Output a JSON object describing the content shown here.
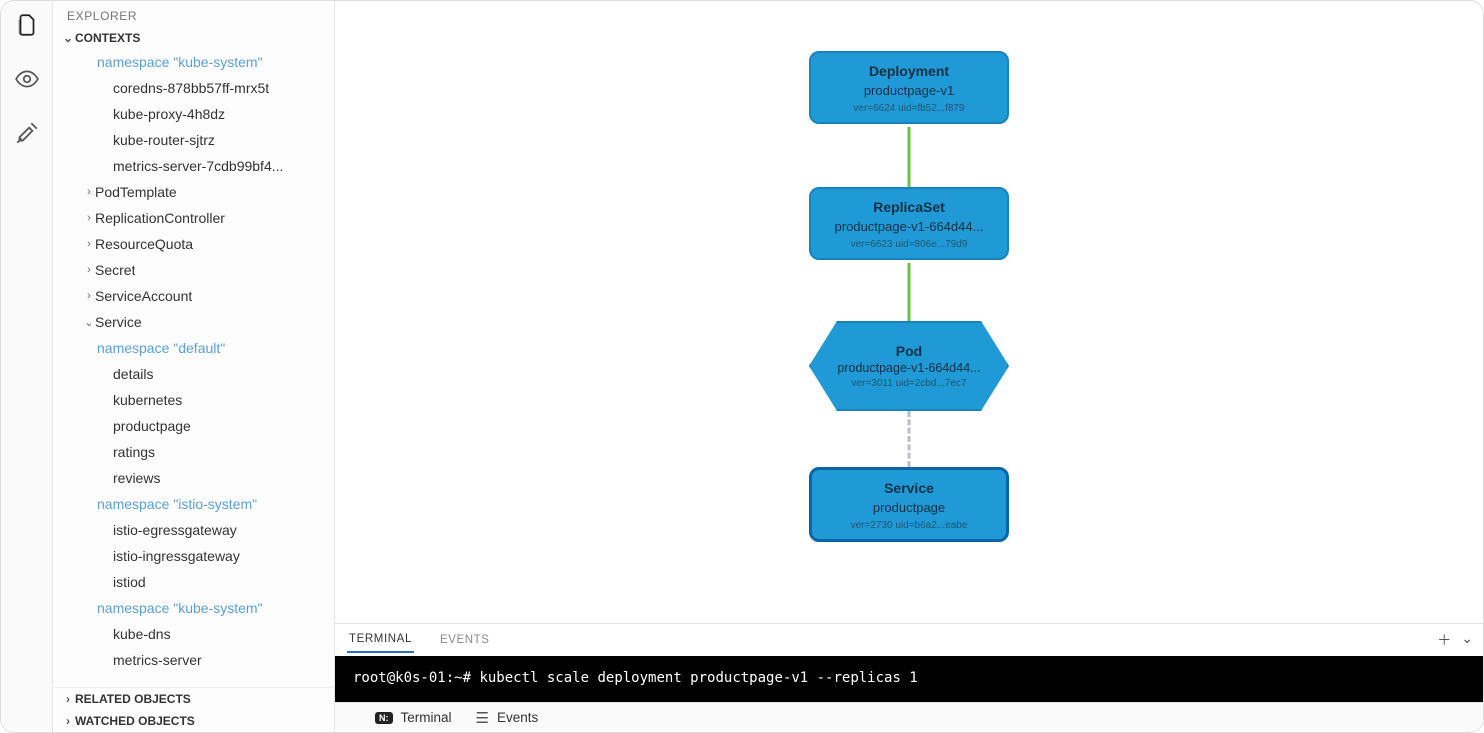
{
  "sidebar": {
    "header": "EXPLORER",
    "sections": {
      "contexts": "CONTEXTS",
      "related": "RELATED OBJECTS",
      "watched": "WATCHED OBJECTS"
    },
    "tree": {
      "namespace_kube_system_top": "namespace \"kube-system\"",
      "pods_ks": [
        "coredns-878bb57ff-mrx5t",
        "kube-proxy-4h8dz",
        "kube-router-sjtrz",
        "metrics-server-7cdb99bf4..."
      ],
      "kinds": [
        "PodTemplate",
        "ReplicationController",
        "ResourceQuota",
        "Secret",
        "ServiceAccount"
      ],
      "service_kind": "Service",
      "ns_default": "namespace \"default\"",
      "svc_default": [
        "details",
        "kubernetes",
        "productpage",
        "ratings",
        "reviews"
      ],
      "ns_istio": "namespace \"istio-system\"",
      "svc_istio": [
        "istio-egressgateway",
        "istio-ingressgateway",
        "istiod"
      ],
      "ns_ks2": "namespace \"kube-system\"",
      "svc_ks": [
        "kube-dns",
        "metrics-server"
      ]
    }
  },
  "graph": {
    "deployment": {
      "type": "Deployment",
      "name": "productpage-v1",
      "meta": "ver=6624 uid=fb52...f879"
    },
    "replicaset": {
      "type": "ReplicaSet",
      "name": "productpage-v1-664d44...",
      "meta": "ver=6623 uid=806e...79d9"
    },
    "pod": {
      "type": "Pod",
      "name": "productpage-v1-664d44...",
      "meta": "ver=3011 uid=2cbd...7ec7"
    },
    "service": {
      "type": "Service",
      "name": "productpage",
      "meta": "ver=2730 uid=b6a2...eabe"
    }
  },
  "panel": {
    "tabs": {
      "terminal": "TERMINAL",
      "events": "EVENTS"
    },
    "terminal": {
      "prompt": "root@k0s-01:~#",
      "command": "kubectl scale deployment productpage-v1 --replicas 1"
    }
  },
  "status": {
    "terminal": "Terminal",
    "events": "Events",
    "terminal_badge": "N:"
  }
}
